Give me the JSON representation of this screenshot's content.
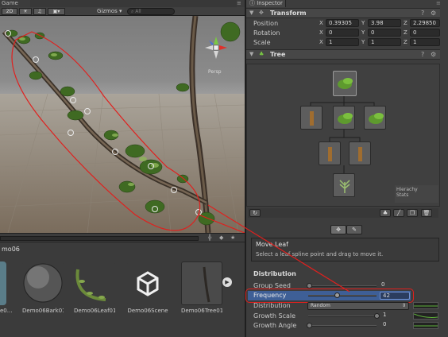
{
  "scene": {
    "tab_label": "Game",
    "btn_2d": "2D",
    "gizmos": "Gizmos",
    "search_all": "All",
    "persp_label": "Persp"
  },
  "project": {
    "breadcrumb": "mo06",
    "assets": [
      {
        "label": "Demo06Bark01",
        "type": "material"
      },
      {
        "label": "Demo06Leaf01",
        "type": "material"
      },
      {
        "label": "Demo06Scene",
        "type": "scene"
      },
      {
        "label": "Demo06Tree01",
        "type": "prefab"
      }
    ],
    "partial_left_label": "e0..."
  },
  "inspector": {
    "tab_label": "Inspector",
    "transform": {
      "title": "Transform",
      "position_label": "Position",
      "rotation_label": "Rotation",
      "scale_label": "Scale",
      "position": {
        "x": "0.39305",
        "y": "3.98",
        "z": "2.29850"
      },
      "rotation": {
        "x": "0",
        "y": "0",
        "z": "0"
      },
      "scale": {
        "x": "1",
        "y": "1",
        "z": "1"
      }
    },
    "tree": {
      "title": "Tree",
      "hierarchy_stats": "Hierachy\nStats",
      "help_title": "Move Leaf",
      "help_desc": "Select a leaf spline point and drag to move it.",
      "distribution_header": "Distribution",
      "group_seed_label": "Group Seed",
      "group_seed_value": "0",
      "frequency_label": "Frequency",
      "frequency_value": "42",
      "distribution_label": "Distribution",
      "distribution_value": "Random",
      "growth_scale_label": "Growth Scale",
      "growth_scale_value": "1",
      "growth_angle_label": "Growth Angle",
      "growth_angle_value": "0"
    }
  },
  "colors": {
    "annotation_red": "#e0201e",
    "selection_blue": "#3e5f96",
    "inspector_bg": "#3d3d3d"
  }
}
